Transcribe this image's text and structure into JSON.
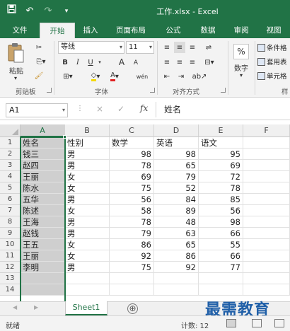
{
  "title_bar": {
    "title": "工作.xlsx - Excel",
    "save_icon": "save-icon",
    "undo_icon": "undo-icon",
    "redo_icon": "redo-icon",
    "customize_icon": "customize-qat-icon"
  },
  "ribbon_tabs": [
    "文件",
    "开始",
    "插入",
    "页面布局",
    "公式",
    "数据",
    "审阅",
    "视图"
  ],
  "active_tab": "开始",
  "ribbon": {
    "clipboard": {
      "label": "剪贴板",
      "paste": "粘贴"
    },
    "font": {
      "label": "字体",
      "font_name": "等线",
      "font_size": "11",
      "bold": "B",
      "italic": "I",
      "underline": "U",
      "grow": "A",
      "shrink": "A",
      "font_color": "A",
      "phonetic": "wén"
    },
    "alignment": {
      "label": "对齐方式"
    },
    "number": {
      "label": "数字",
      "percent": "%"
    },
    "styles": {
      "label": "样",
      "conditional": "条件格",
      "table": "套用表",
      "cell": "单元格"
    }
  },
  "formula_bar": {
    "name_box": "A1",
    "cancel": "×",
    "enter": "✓",
    "fx": "fx",
    "content": "姓名"
  },
  "sheet": {
    "columns": [
      "A",
      "B",
      "C",
      "D",
      "E",
      "F"
    ],
    "selected_column": "A",
    "row_numbers": [
      "1",
      "2",
      "3",
      "4",
      "5",
      "6",
      "7",
      "8",
      "9",
      "10",
      "11",
      "12",
      "13",
      "14"
    ],
    "header": [
      "姓名",
      "性别",
      "数学",
      "英语",
      "语文"
    ],
    "rows": [
      [
        "钱三",
        "男",
        "98",
        "98",
        "95"
      ],
      [
        "赵四",
        "男",
        "78",
        "65",
        "69"
      ],
      [
        "王丽",
        "女",
        "69",
        "79",
        "72"
      ],
      [
        "陈水",
        "女",
        "75",
        "52",
        "78"
      ],
      [
        "五华",
        "男",
        "56",
        "84",
        "85"
      ],
      [
        "陈述",
        "女",
        "58",
        "89",
        "56"
      ],
      [
        "王海",
        "男",
        "78",
        "48",
        "98"
      ],
      [
        "赵钱",
        "男",
        "79",
        "63",
        "66"
      ],
      [
        "王五",
        "女",
        "86",
        "65",
        "55"
      ],
      [
        "王丽",
        "女",
        "92",
        "86",
        "66"
      ],
      [
        "李明",
        "男",
        "75",
        "92",
        "77"
      ]
    ]
  },
  "sheet_tabs": {
    "tabs": [
      "Sheet1"
    ],
    "add_icon": "add-sheet-icon",
    "add_symbol": "⊕"
  },
  "watermark": "最需教育",
  "status_bar": {
    "ready": "就绪",
    "count": "计数: 12"
  },
  "colors": {
    "accent": "#217346",
    "selection_fill": "#cfcfcf",
    "watermark": "#1f5fa8"
  }
}
